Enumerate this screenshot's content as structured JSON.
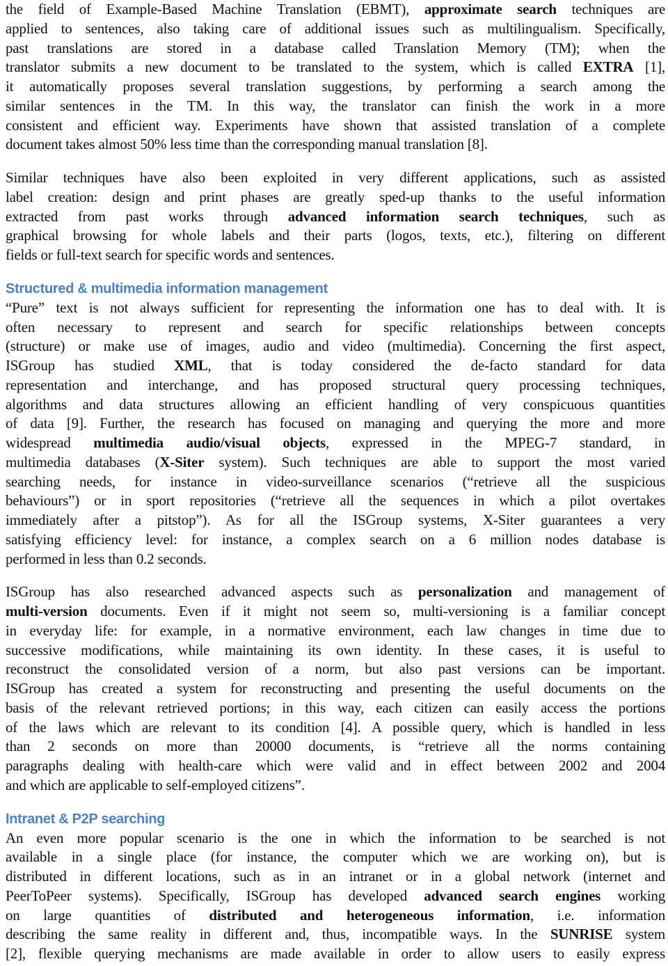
{
  "document": {
    "accent_color": "#4f81bd",
    "blocks": [
      {
        "type": "paragraph",
        "name": "ebmt-paragraph",
        "lines": [
          [
            {
              "t": "the field of Example-Based Machine Translation (EBMT), "
            },
            {
              "t": "approximate search",
              "b": true
            },
            {
              "t": " techniques are"
            }
          ],
          [
            {
              "t": "applied to sentences, also taking care of additional issues such as multilingualism. Specifically,"
            }
          ],
          [
            {
              "t": "past translations are stored in a database called Translation Memory (TM); when the"
            }
          ],
          [
            {
              "t": "translator submits a new document to be translated to the system, which is called "
            },
            {
              "t": "EXTRA",
              "b": true
            },
            {
              "t": " [1],"
            }
          ],
          [
            {
              "t": "it automatically proposes several translation suggestions, by performing a search among the"
            }
          ],
          [
            {
              "t": "similar sentences in the TM. In this way, the translator can finish the work in a more"
            }
          ],
          [
            {
              "t": "consistent and efficient way.  Experiments have shown that assisted translation of a complete"
            }
          ],
          [
            {
              "t": "document takes almost 50% less time than the corresponding manual translation [8]."
            }
          ]
        ]
      },
      {
        "type": "paragraph",
        "name": "label-creation-paragraph",
        "lines": [
          [
            {
              "t": "Similar techniques have also been exploited in very different applications, such as assisted"
            }
          ],
          [
            {
              "t": "label creation: design and print phases are greatly sped-up thanks to the useful information"
            }
          ],
          [
            {
              "t": "extracted from past works through "
            },
            {
              "t": "advanced information search techniques",
              "b": true
            },
            {
              "t": ", such as"
            }
          ],
          [
            {
              "t": "graphical browsing for whole labels and their parts (logos, texts, etc.), filtering on different"
            }
          ],
          [
            {
              "t": "fields or full-text search for specific words and sentences."
            }
          ]
        ]
      },
      {
        "type": "heading",
        "name": "section-heading-structured-multimedia",
        "text": "Structured & multimedia information management"
      },
      {
        "type": "paragraph",
        "name": "structured-multimedia-paragraph",
        "lines": [
          [
            {
              "t": "“Pure” text is not always sufficient for representing the information one has to deal with.  It is"
            }
          ],
          [
            {
              "t": "often necessary to represent and search for specific relationships between concepts"
            }
          ],
          [
            {
              "t": "(structure) or make use of images, audio and video (multimedia). Concerning the first aspect,"
            }
          ],
          [
            {
              "t": "ISGroup has studied "
            },
            {
              "t": "XML",
              "b": true
            },
            {
              "t": ", that is today considered the de-facto standard for data"
            }
          ],
          [
            {
              "t": "representation and interchange, and has proposed structural query processing techniques,"
            }
          ],
          [
            {
              "t": "algorithms and data structures allowing an efficient handling of very conspicuous quantities"
            }
          ],
          [
            {
              "t": "of data [9]. Further, the research has focused on managing and querying the more and more"
            }
          ],
          [
            {
              "t": "widespread "
            },
            {
              "t": "multimedia audio/visual objects",
              "b": true
            },
            {
              "t": ", expressed in the MPEG-7 standard, in"
            }
          ],
          [
            {
              "t": "multimedia databases ("
            },
            {
              "t": "X-Siter",
              "b": true
            },
            {
              "t": " system). Such techniques are able to support the most varied"
            }
          ],
          [
            {
              "t": "searching needs, for instance in video-surveillance scenarios (“retrieve all the suspicious"
            }
          ],
          [
            {
              "t": "behaviours”) or in sport repositories (“retrieve all the sequences in which a pilot overtakes"
            }
          ],
          [
            {
              "t": "immediately after a pitstop”). As for all the ISGroup systems, X-Siter guarantees a very"
            }
          ],
          [
            {
              "t": "satisfying efficiency level: for instance, a complex search on a 6 million nodes database is"
            }
          ],
          [
            {
              "t": "performed in less than 0.2 seconds."
            }
          ]
        ]
      },
      {
        "type": "paragraph",
        "name": "multi-version-paragraph",
        "lines": [
          [
            {
              "t": "ISGroup has also researched advanced aspects such as "
            },
            {
              "t": "personalization",
              "b": true
            },
            {
              "t": " and management of"
            }
          ],
          [
            {
              "t": "multi-version",
              "b": true
            },
            {
              "t": " documents. Even if it might not seem so, multi-versioning is a familiar concept"
            }
          ],
          [
            {
              "t": "in everyday life: for example, in a normative environment, each law changes in time due to"
            }
          ],
          [
            {
              "t": "successive modifications, while maintaining its own identity. In these cases, it is useful to"
            }
          ],
          [
            {
              "t": "reconstruct the consolidated version of a norm, but also past versions can be important."
            }
          ],
          [
            {
              "t": "ISGroup has created a system for reconstructing and presenting the useful documents on the"
            }
          ],
          [
            {
              "t": "basis of the relevant retrieved portions; in this way, each citizen can easily access the portions"
            }
          ],
          [
            {
              "t": "of the laws which are relevant to its condition [4]. A possible query, which is handled in less"
            }
          ],
          [
            {
              "t": "than 2 seconds on more than 20000 documents, is “retrieve all the norms containing"
            }
          ],
          [
            {
              "t": "paragraphs dealing with health-care which were valid and in effect between 2002 and 2004"
            }
          ],
          [
            {
              "t": "and which are applicable to self-employed citizens”."
            }
          ]
        ]
      },
      {
        "type": "heading",
        "name": "section-heading-intranet-p2p",
        "text": "Intranet & P2P searching"
      },
      {
        "type": "paragraph",
        "name": "intranet-p2p-paragraph",
        "open_ended": true,
        "lines": [
          [
            {
              "t": "An even more popular scenario is the one in which the information to be searched is not"
            }
          ],
          [
            {
              "t": "available in a single place (for instance, the computer which we are working on), but is"
            }
          ],
          [
            {
              "t": "distributed in different locations, such as in an intranet or in a global network (internet and"
            }
          ],
          [
            {
              "t": "PeerToPeer systems). Specifically, ISGroup has developed "
            },
            {
              "t": "advanced search engines",
              "b": true
            },
            {
              "t": " working"
            }
          ],
          [
            {
              "t": "on large quantities of "
            },
            {
              "t": "distributed and heterogeneous information",
              "b": true
            },
            {
              "t": ", i.e. information"
            }
          ],
          [
            {
              "t": "describing the same reality in different and, thus, incompatible ways. In the "
            },
            {
              "t": "SUNRISE",
              "b": true
            },
            {
              "t": " system"
            }
          ],
          [
            {
              "t": "[2], flexible querying mechanisms are made available in order to allow users to easily express"
            }
          ]
        ]
      }
    ]
  }
}
